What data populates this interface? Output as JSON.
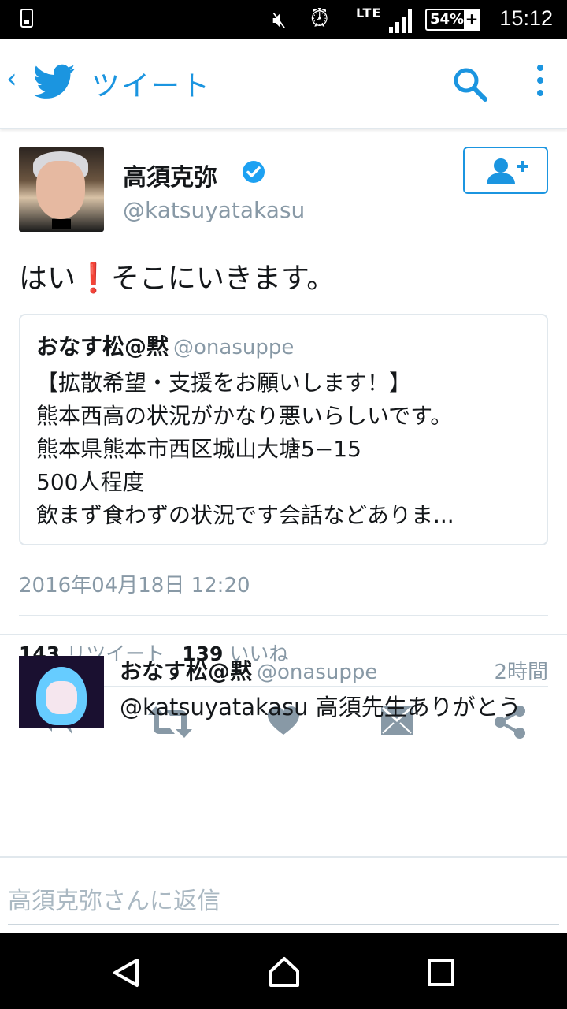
{
  "status_bar": {
    "lte": "LTE",
    "battery": "54%",
    "time": "15:12"
  },
  "app_bar": {
    "back_icon": "chevron-left-icon",
    "logo_icon": "twitter-bird-icon",
    "title": "ツイート",
    "accent": "#1b95e0"
  },
  "tweet": {
    "name": "高須克弥",
    "handle": "@katsuyatakasu",
    "text_before": "はい",
    "text_emoji": "❗",
    "text_after": "そこにいきます。",
    "quote": {
      "name": "おなす松@黙",
      "handle": "@onasuppe",
      "lines": [
        "【拡散希望・支援をお願いします！】",
        "熊本西高の状況がかなり悪いらしいです。",
        "熊本県熊本市西区城山大塘5−15",
        "500人程度",
        "飲まず食わずの状況です会話などありま..."
      ]
    },
    "date": "2016年04月18日 12:20",
    "retweets": "143",
    "retweets_label": "リツイート",
    "likes": "139",
    "likes_label": "いいね"
  },
  "reply": {
    "name": "おなす松@黙",
    "handle": "@onasuppe",
    "time": "2時間",
    "text": "@katsuyatakasu 高須先生ありがとう"
  },
  "compose": {
    "placeholder": "高須克弥さんに返信"
  }
}
